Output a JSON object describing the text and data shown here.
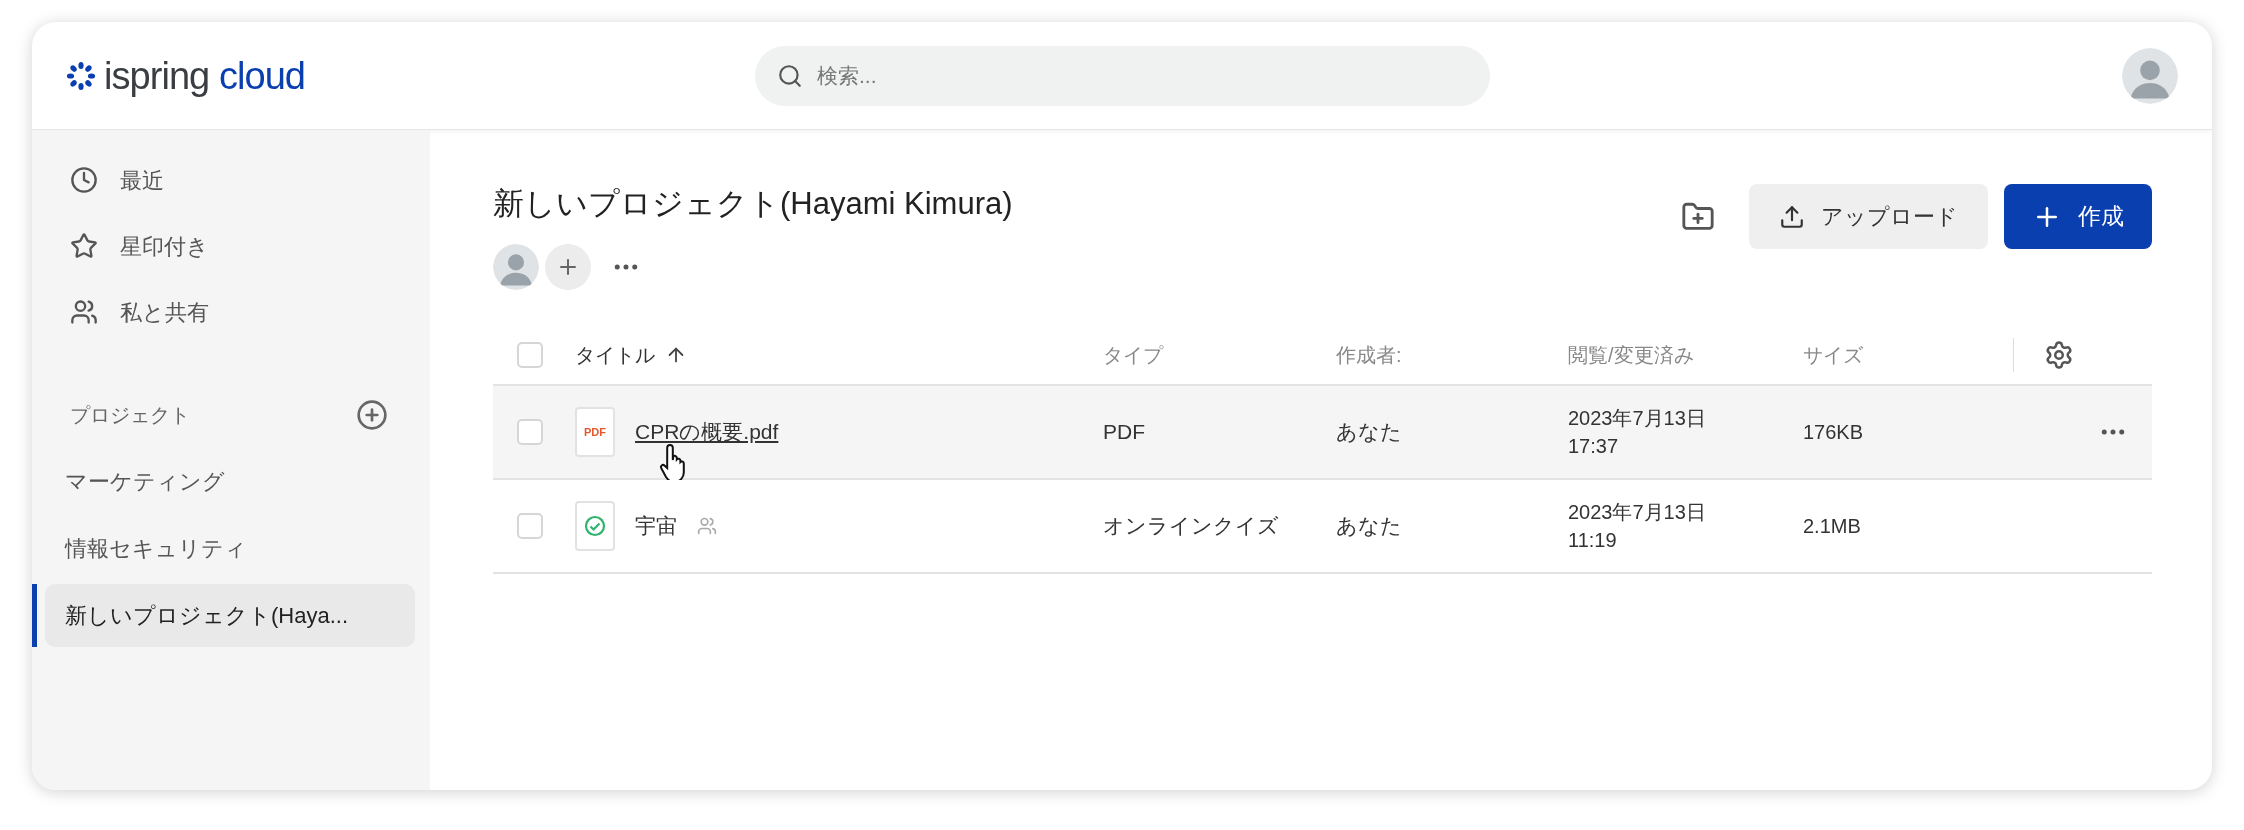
{
  "logo": {
    "word": "ispring",
    "suffix": "cloud"
  },
  "search": {
    "placeholder": "検索..."
  },
  "sidebar": {
    "nav": [
      {
        "label": "最近",
        "selected": false
      },
      {
        "label": "星印付き",
        "selected": false
      },
      {
        "label": "私と共有",
        "selected": false
      }
    ],
    "projects_heading": "プロジェクト",
    "projects": [
      {
        "label": "マーケティング",
        "selected": false
      },
      {
        "label": "情報セキュリティ",
        "selected": false
      },
      {
        "label": "新しいプロジェクト(Haya...",
        "selected": true
      }
    ]
  },
  "page": {
    "title": "新しいプロジェクト(Hayami Kimura)",
    "upload_button": "アップロード",
    "create_button": "作成"
  },
  "table": {
    "all_checked": false,
    "columns": [
      {
        "label": "タイトル",
        "sorted": true
      },
      {
        "label": "タイプ",
        "sorted": false
      },
      {
        "label": "作成者:",
        "sorted": false
      },
      {
        "label": "閲覧/変更済み",
        "sorted": false
      },
      {
        "label": "サイズ",
        "sorted": false
      }
    ],
    "rows": [
      {
        "kind": "pdf",
        "badge": "PDF",
        "title": "CPRの概要.pdf",
        "shared": false,
        "hovered": true,
        "checked": false,
        "type": "PDF",
        "author": "あなた",
        "date": "2023年7月13日",
        "time": "17:37",
        "size": "176KB"
      },
      {
        "kind": "quiz",
        "title": "宇宙",
        "shared": true,
        "hovered": false,
        "checked": false,
        "type": "オンラインクイズ",
        "author": "あなた",
        "date": "2023年7月13日",
        "time": "11:19",
        "size": "2.1MB"
      }
    ]
  }
}
